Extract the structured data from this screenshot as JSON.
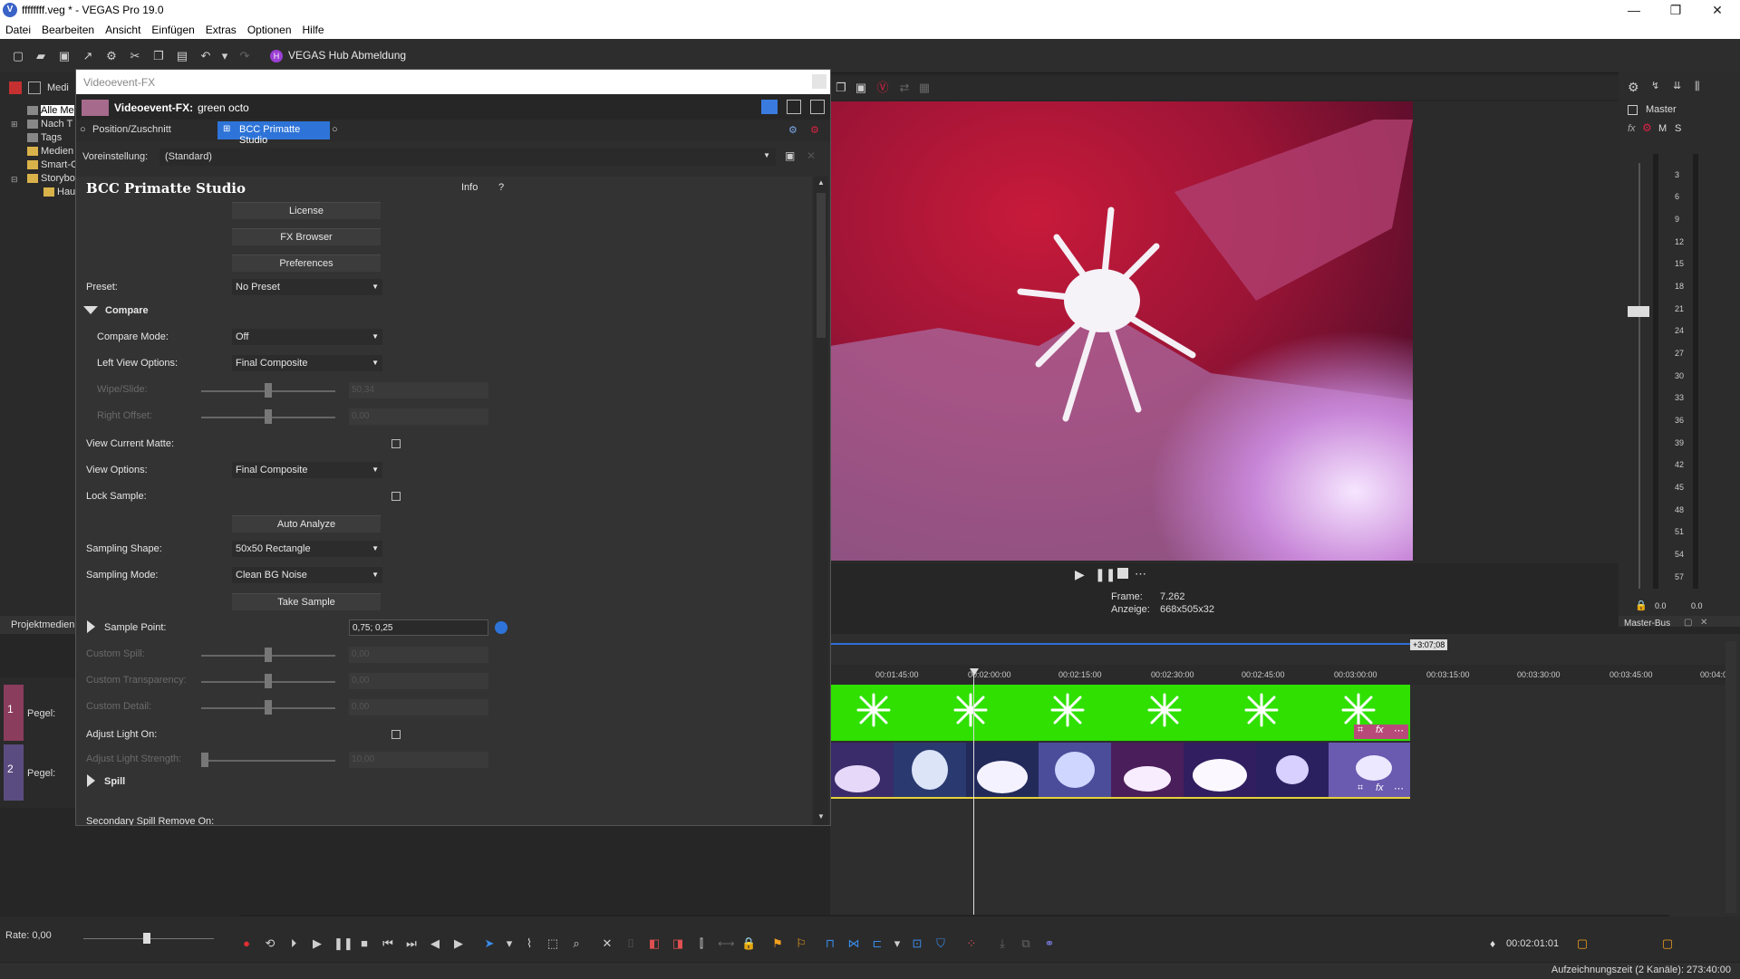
{
  "window": {
    "title": "ffffffff.veg * - VEGAS Pro 19.0",
    "minimize": "—",
    "maximize": "❐",
    "close": "✕"
  },
  "menu": [
    "Datei",
    "Bearbeiten",
    "Ansicht",
    "Einfügen",
    "Extras",
    "Optionen",
    "Hilfe"
  ],
  "toolbar": {
    "hub_label": "VEGAS Hub Abmeldung"
  },
  "explorer": {
    "items": [
      "Alle Me",
      "Nach T",
      "Tags",
      "Medien",
      "Smart-C",
      "Storybo",
      "Hau"
    ],
    "tab": "Projektmedien"
  },
  "fx": {
    "window_title": "Videoevent-FX",
    "header_label": "Videoevent-FX:",
    "header_value": "green octo",
    "chain_first": "Position/Zuschnitt",
    "chain_active": "BCC Primatte Studio",
    "preset_label": "Voreinstellung:",
    "preset_value": "(Standard)"
  },
  "plugin": {
    "title": "BCC Primatte Studio",
    "info": "Info",
    "help": "?",
    "license": "License",
    "fx_browser": "FX Browser",
    "preferences": "Preferences",
    "preset_label": "Preset:",
    "preset_value": "No Preset",
    "compare_section": "Compare",
    "compare_mode_label": "Compare Mode:",
    "compare_mode_value": "Off",
    "left_view_label": "Left View Options:",
    "left_view_value": "Final Composite",
    "wipe_slide_label": "Wipe/Slide:",
    "wipe_slide_value": "50,34",
    "right_offset_label": "Right Offset:",
    "right_offset_value": "0,00",
    "view_current_matte_label": "View Current Matte:",
    "view_options_label": "View Options:",
    "view_options_value": "Final Composite",
    "lock_sample_label": "Lock Sample:",
    "auto_analyze": "Auto Analyze",
    "sampling_shape_label": "Sampling Shape:",
    "sampling_shape_value": "50x50 Rectangle",
    "sampling_mode_label": "Sampling Mode:",
    "sampling_mode_value": "Clean BG Noise",
    "take_sample": "Take Sample",
    "sample_point_label": "Sample Point:",
    "sample_point_value": "0,75; 0,25",
    "custom_spill_label": "Custom Spill:",
    "custom_spill_value": "0,00",
    "custom_transparency_label": "Custom Transparency:",
    "custom_transparency_value": "0,00",
    "custom_detail_label": "Custom Detail:",
    "custom_detail_value": "0,00",
    "adjust_light_on_label": "Adjust Light On:",
    "adjust_light_strength_label": "Adjust Light Strength:",
    "adjust_light_strength_value": "10,00",
    "spill_section": "Spill",
    "secondary_spill_label": "Secondary Spill Remove On:"
  },
  "preview": {
    "frame_label": "Frame:",
    "frame_value": "7.262",
    "display_label": "Anzeige:",
    "display_value": "668x505x32"
  },
  "master": {
    "label": "Master",
    "fx": "fx",
    "m": "M",
    "s": "S",
    "scale": [
      "3",
      "6",
      "9",
      "12",
      "15",
      "18",
      "21",
      "24",
      "27",
      "30",
      "33",
      "36",
      "39",
      "42",
      "45",
      "48",
      "51",
      "54",
      "57"
    ],
    "left_value": "0.0",
    "right_value": "0.0",
    "bus_label": "Master-Bus"
  },
  "timeline": {
    "end_marker": "+3:07;08",
    "ruler": [
      "00:01:45:00",
      "00:02:00:00",
      "00:02:15:00",
      "00:02:30:00",
      "00:02:45:00",
      "00:03:00:00",
      "00:03:15:00",
      "00:03:30:00",
      "00:03:45:00",
      "00:04:0"
    ],
    "track1_label": "Pegel:",
    "track2_label": "Pegel:",
    "track1_num": "1",
    "track2_num": "2"
  },
  "bottom": {
    "rate": "Rate: 0,00",
    "timecode": "00:02:01:01",
    "status": "Aufzeichnungszeit (2 Kanäle): 273:40:00"
  }
}
